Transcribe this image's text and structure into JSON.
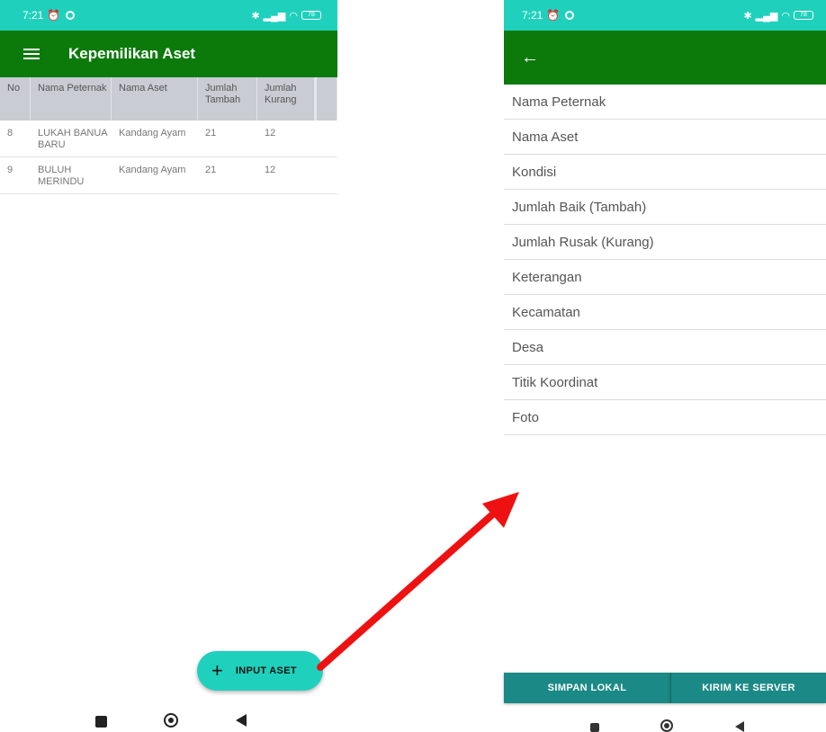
{
  "status_bar": {
    "time": "7:21",
    "battery": "78"
  },
  "left_screen": {
    "title": "Kepemilikan Aset",
    "columns": [
      "No",
      "Nama Peternak",
      "Nama Aset",
      "Jumlah Tambah",
      "Jumlah Kurang"
    ],
    "rows": [
      {
        "no": "8",
        "nama": "LUKAH BANUA BARU",
        "aset": "Kandang Ayam",
        "tambah": "21",
        "kurang": "12"
      },
      {
        "no": "9",
        "nama": "BULUH MERINDU",
        "aset": "Kandang Ayam",
        "tambah": "21",
        "kurang": "12"
      }
    ],
    "fab_label": "INPUT ASET"
  },
  "right_screen": {
    "fields": [
      "Nama Peternak",
      "Nama Aset",
      "Kondisi",
      "Jumlah Baik (Tambah)",
      "Jumlah Rusak (Kurang)",
      "Keterangan",
      "Kecamatan",
      "Desa",
      "Titik Koordinat",
      "Foto"
    ],
    "simpan_label": "SIMPAN LOKAL",
    "kirim_label": "KIRIM KE SERVER"
  },
  "colors": {
    "status_bar": "#1fd1bc",
    "app_bar": "#0b7a0b",
    "button": "#1b8a86",
    "arrow": "#ee1111"
  },
  "icons": [
    "menu-icon",
    "back-arrow-icon",
    "plus-icon",
    "alarm-icon",
    "bluetooth-icon",
    "signal-icon",
    "wifi-icon",
    "battery-icon"
  ]
}
